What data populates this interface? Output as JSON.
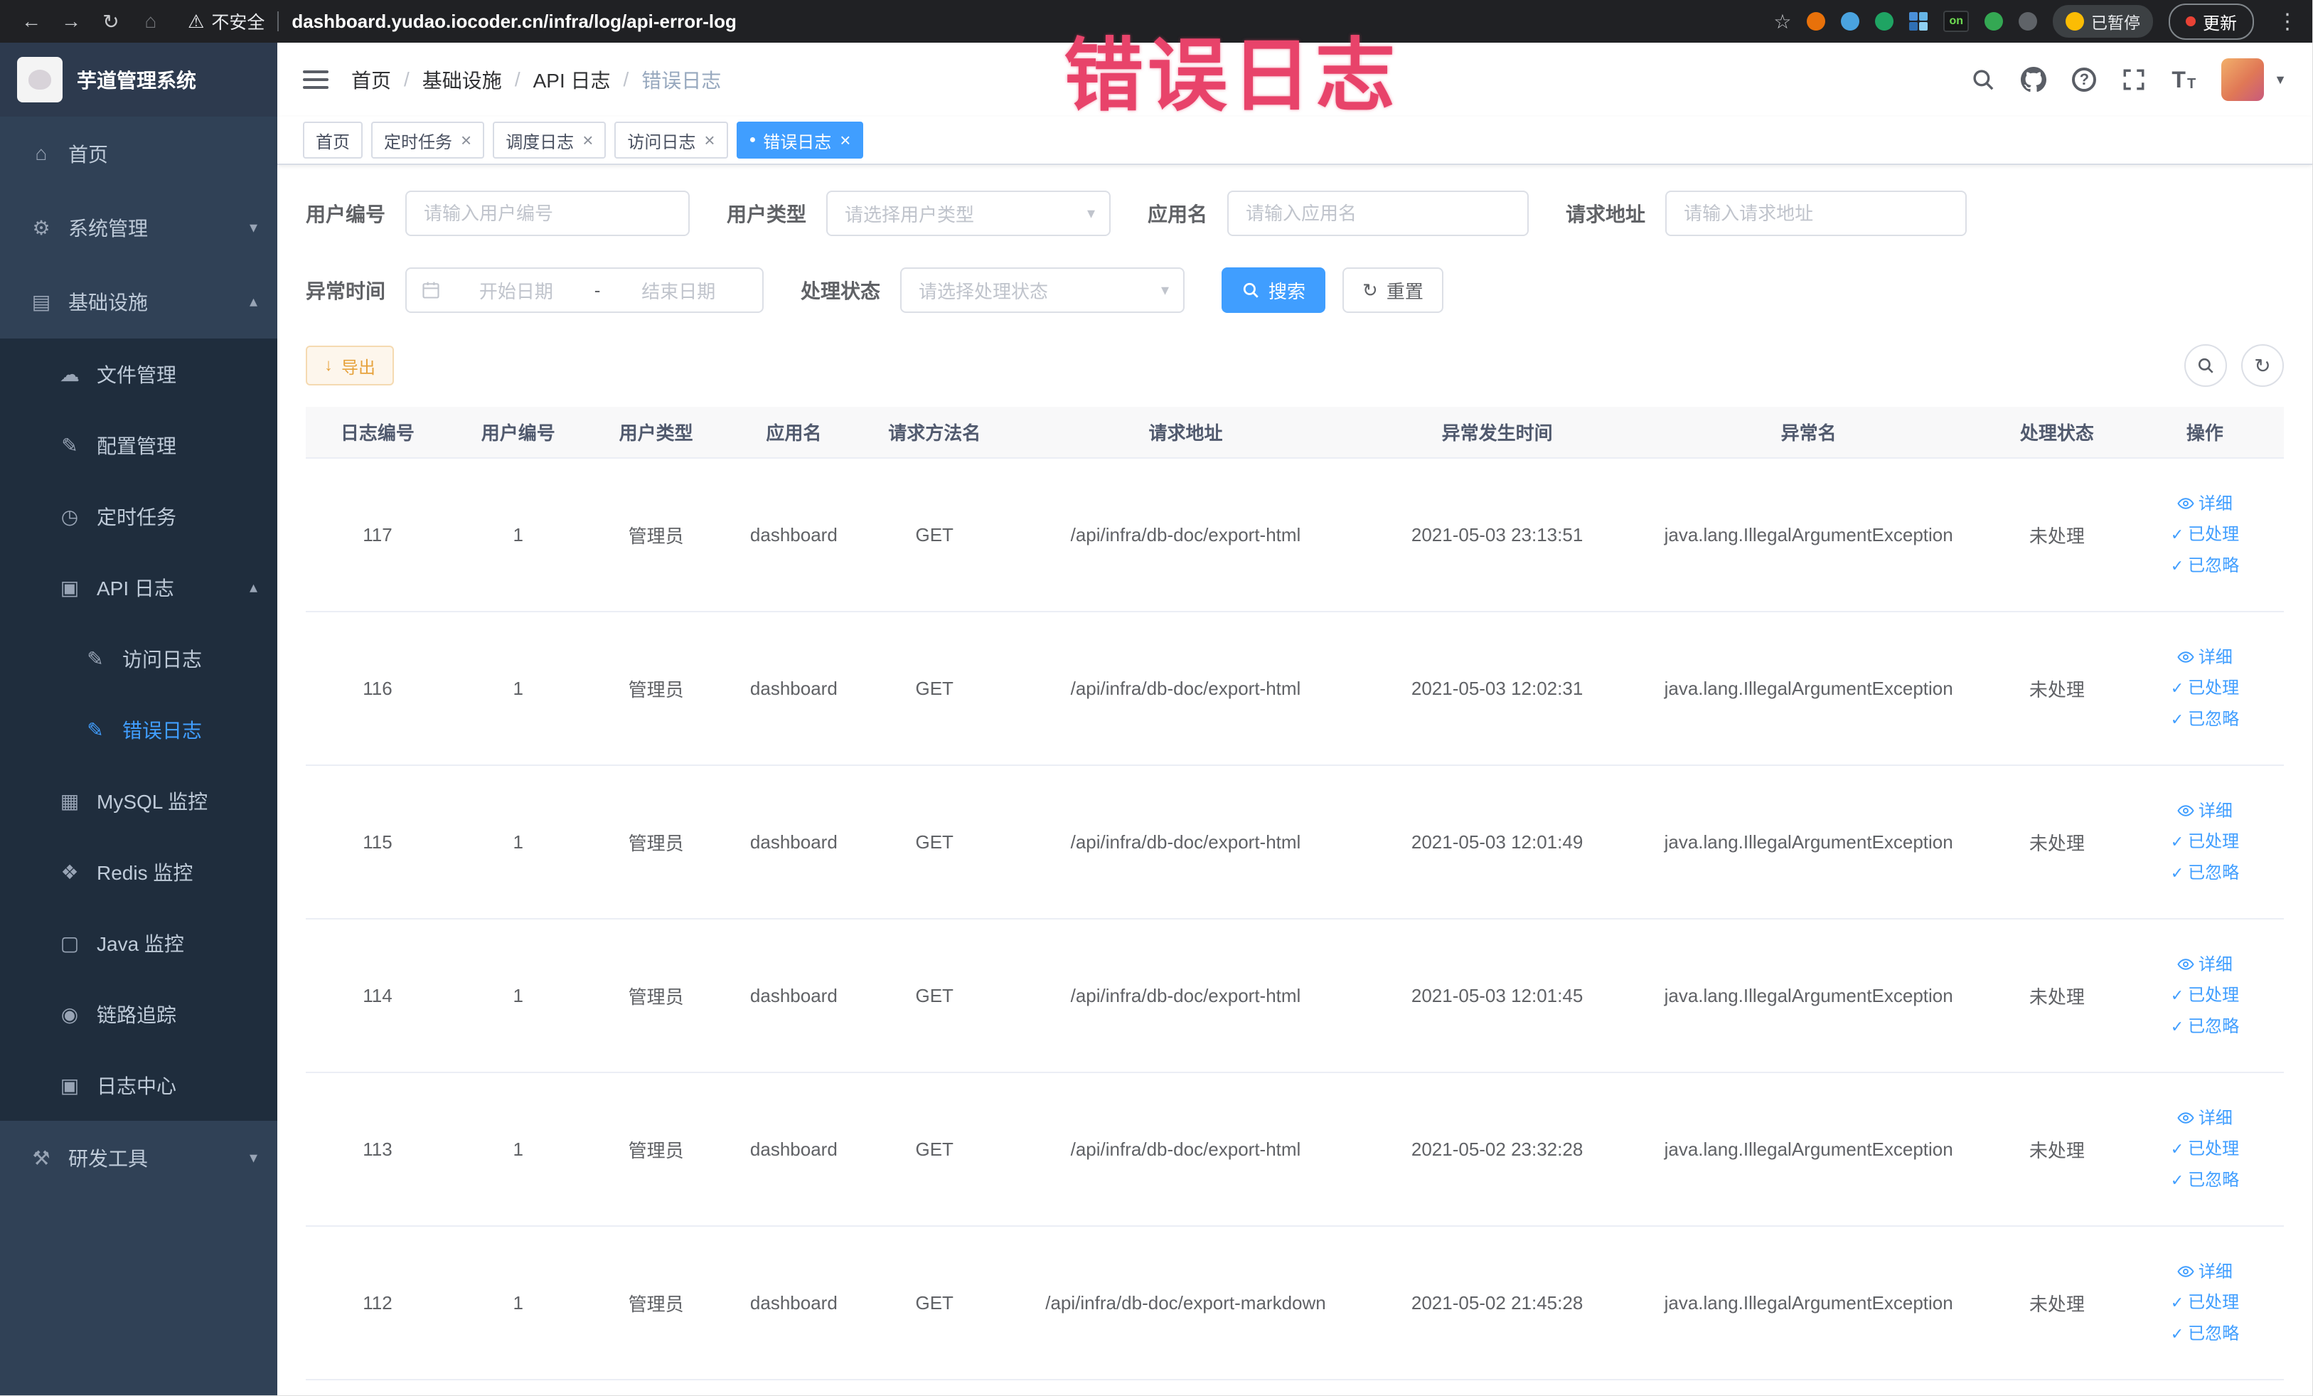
{
  "browser": {
    "security_label": "不安全",
    "url": "dashboard.yudao.iocoder.cn/infra/log/api-error-log",
    "paused_badge": "已暂停",
    "update_button": "更新",
    "extension_on_badge": "on"
  },
  "watermark": {
    "text": "错误日志"
  },
  "colors": {
    "primary": "#409eff",
    "warning_text": "#e6a23c",
    "sidebar_bg": "#304156",
    "submenu_bg": "#1f2d3d",
    "watermark": "#e8436a"
  },
  "sidebar": {
    "logo_title": "芋道管理系统",
    "items": [
      {
        "label": "首页"
      },
      {
        "label": "系统管理"
      },
      {
        "label": "基础设施"
      },
      {
        "label": "文件管理"
      },
      {
        "label": "配置管理"
      },
      {
        "label": "定时任务"
      },
      {
        "label": "API 日志"
      },
      {
        "label": "访问日志"
      },
      {
        "label": "错误日志"
      },
      {
        "label": "MySQL 监控"
      },
      {
        "label": "Redis 监控"
      },
      {
        "label": "Java 监控"
      },
      {
        "label": "链路追踪"
      },
      {
        "label": "日志中心"
      },
      {
        "label": "研发工具"
      }
    ]
  },
  "breadcrumb": {
    "items": [
      "首页",
      "基础设施",
      "API 日志",
      "错误日志"
    ]
  },
  "tabs": [
    {
      "label": "首页"
    },
    {
      "label": "定时任务"
    },
    {
      "label": "调度日志"
    },
    {
      "label": "访问日志"
    },
    {
      "label": "错误日志"
    }
  ],
  "filters": {
    "user_id": {
      "label": "用户编号",
      "placeholder": "请输入用户编号"
    },
    "user_type": {
      "label": "用户类型",
      "placeholder": "请选择用户类型"
    },
    "app_name": {
      "label": "应用名",
      "placeholder": "请输入应用名"
    },
    "request_url": {
      "label": "请求地址",
      "placeholder": "请输入请求地址"
    },
    "exception_time": {
      "label": "异常时间",
      "start_placeholder": "开始日期",
      "separator": "-",
      "end_placeholder": "结束日期"
    },
    "process_status": {
      "label": "处理状态",
      "placeholder": "请选择处理状态"
    },
    "search_label": "搜索",
    "reset_label": "重置"
  },
  "toolbar": {
    "export_label": "导出"
  },
  "table": {
    "columns": [
      "日志编号",
      "用户编号",
      "用户类型",
      "应用名",
      "请求方法名",
      "请求地址",
      "异常发生时间",
      "异常名",
      "处理状态",
      "操作"
    ],
    "actions": {
      "detail": "详细",
      "processed": "已处理",
      "ignored": "已忽略"
    },
    "rows": [
      {
        "id": "117",
        "user_id": "1",
        "user_type": "管理员",
        "app_name": "dashboard",
        "method": "GET",
        "url": "/api/infra/db-doc/export-html",
        "time": "2021-05-03 23:13:51",
        "exception": "java.lang.IllegalArgumentException",
        "status": "未处理"
      },
      {
        "id": "116",
        "user_id": "1",
        "user_type": "管理员",
        "app_name": "dashboard",
        "method": "GET",
        "url": "/api/infra/db-doc/export-html",
        "time": "2021-05-03 12:02:31",
        "exception": "java.lang.IllegalArgumentException",
        "status": "未处理"
      },
      {
        "id": "115",
        "user_id": "1",
        "user_type": "管理员",
        "app_name": "dashboard",
        "method": "GET",
        "url": "/api/infra/db-doc/export-html",
        "time": "2021-05-03 12:01:49",
        "exception": "java.lang.IllegalArgumentException",
        "status": "未处理"
      },
      {
        "id": "114",
        "user_id": "1",
        "user_type": "管理员",
        "app_name": "dashboard",
        "method": "GET",
        "url": "/api/infra/db-doc/export-html",
        "time": "2021-05-03 12:01:45",
        "exception": "java.lang.IllegalArgumentException",
        "status": "未处理"
      },
      {
        "id": "113",
        "user_id": "1",
        "user_type": "管理员",
        "app_name": "dashboard",
        "method": "GET",
        "url": "/api/infra/db-doc/export-html",
        "time": "2021-05-02 23:32:28",
        "exception": "java.lang.IllegalArgumentException",
        "status": "未处理"
      },
      {
        "id": "112",
        "user_id": "1",
        "user_type": "管理员",
        "app_name": "dashboard",
        "method": "GET",
        "url": "/api/infra/db-doc/export-markdown",
        "time": "2021-05-02 21:45:28",
        "exception": "java.lang.IllegalArgumentException",
        "status": "未处理"
      }
    ]
  },
  "icons": {
    "back": "←",
    "forward": "→",
    "reload": "↻",
    "home": "⌂",
    "warning": "⚠",
    "star": "☆",
    "kebab": "⋮",
    "slash": "/",
    "chevron_down": "▾",
    "chevron_up": "▴",
    "caret_down": "▼",
    "select_caret": "▾",
    "close": "×",
    "active_dot": "●",
    "check": "✓",
    "download": "↓",
    "refresh": "↻",
    "question": "?",
    "size_large": "T",
    "size_small": "T",
    "menu_home": "⌂",
    "menu_system": "⚙",
    "menu_infra": "▤",
    "menu_file": "☁",
    "menu_config": "✎",
    "menu_job": "◷",
    "menu_api_log": "▣",
    "menu_access_log": "✎",
    "menu_error_log": "✎",
    "menu_mysql": "▦",
    "menu_redis": "❖",
    "menu_java": "▢",
    "menu_trace": "◉",
    "menu_log_center": "▣",
    "menu_dev_tools": "⚒"
  }
}
